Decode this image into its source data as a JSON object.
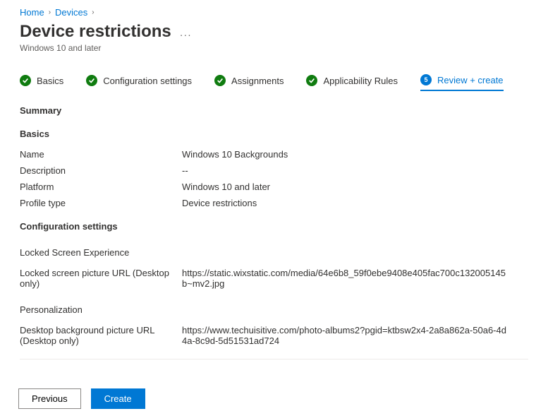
{
  "breadcrumb": {
    "home": "Home",
    "devices": "Devices"
  },
  "page": {
    "title": "Device restrictions",
    "subtitle": "Windows 10 and later"
  },
  "tabs": {
    "basics": "Basics",
    "config": "Configuration settings",
    "assignments": "Assignments",
    "applicability": "Applicability Rules",
    "review": "Review + create",
    "review_num": "5"
  },
  "summary": {
    "heading": "Summary"
  },
  "basics": {
    "heading": "Basics",
    "name_label": "Name",
    "name_value": "Windows 10 Backgrounds",
    "desc_label": "Description",
    "desc_value": "--",
    "platform_label": "Platform",
    "platform_value": "Windows 10 and later",
    "profile_label": "Profile type",
    "profile_value": "Device restrictions"
  },
  "config": {
    "heading": "Configuration settings",
    "locked_heading": "Locked Screen Experience",
    "locked_label": "Locked screen picture URL (Desktop only)",
    "locked_value": "https://static.wixstatic.com/media/64e6b8_59f0ebe9408e405fac700c132005145b~mv2.jpg",
    "personal_heading": "Personalization",
    "desktop_label": "Desktop background picture URL (Desktop only)",
    "desktop_value": "https://www.techuisitive.com/photo-albums2?pgid=ktbsw2x4-2a8a862a-50a6-4d4a-8c9d-5d51531ad724"
  },
  "footer": {
    "previous": "Previous",
    "create": "Create"
  }
}
